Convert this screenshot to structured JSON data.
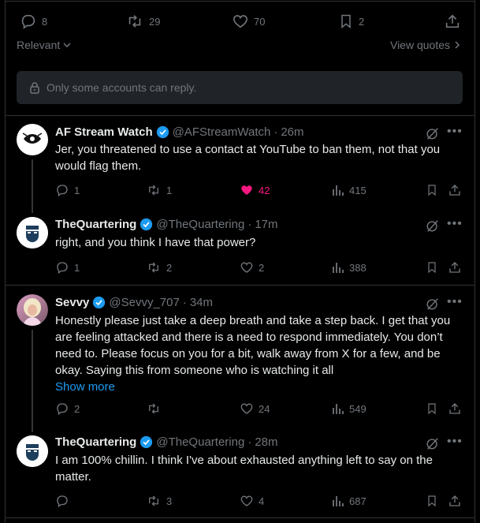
{
  "top_bar": {
    "replies": "8",
    "reposts": "29",
    "likes": "70",
    "bookmarks": "2"
  },
  "sort": {
    "label": "Relevant",
    "view_quotes": "View quotes"
  },
  "reply_restriction": {
    "text": "Only some accounts can reply."
  },
  "tweets": [
    {
      "name": "AF Stream Watch",
      "handle": "@AFStreamWatch",
      "time": "26m",
      "lines": [
        "Jer, you threatened to use a contact at YouTube to ban them, not that you",
        "would flag them."
      ],
      "replies": "1",
      "reposts": "1",
      "likes": "42",
      "views": "415"
    },
    {
      "name": "TheQuartering",
      "handle": "@TheQuartering",
      "time": "17m",
      "lines": [
        "right, and you think I have that power?"
      ],
      "replies": "1",
      "reposts": "2",
      "likes": "2",
      "views": "388"
    },
    {
      "name": "Sevvy",
      "handle": "@Sevvy_707",
      "time": "34m",
      "lines": [
        "Honestly please just take a deep breath and take a step back. I get that you",
        "are feeling attacked and there is a need to respond immediately. You don’t",
        "need to. Please focus on you for a bit, walk away from X for a few, and be",
        "okay. Saying this from someone who is watching it all"
      ],
      "show_more": "Show more",
      "replies": "2",
      "reposts": "",
      "likes": "24",
      "views": "549"
    },
    {
      "name": "TheQuartering",
      "handle": "@TheQuartering",
      "time": "28m",
      "lines": [
        "I am 100% chillin.  I think I've about exhausted anything left to say on the",
        "matter."
      ],
      "replies": "",
      "reposts": "3",
      "likes": "4",
      "views": "687"
    }
  ],
  "colors": {
    "accent": "#1d9bf0",
    "like_active": "#f91880",
    "muted": "#71767b"
  }
}
